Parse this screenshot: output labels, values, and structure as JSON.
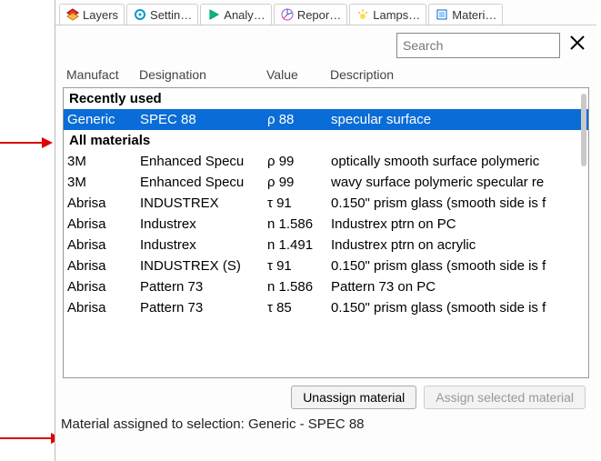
{
  "tabs": [
    {
      "label": "Layers"
    },
    {
      "label": "Settin…"
    },
    {
      "label": "Analy…"
    },
    {
      "label": "Repor…"
    },
    {
      "label": "Lamps…"
    },
    {
      "label": "Materi…"
    }
  ],
  "search": {
    "placeholder": "Search"
  },
  "columns": {
    "manufacturer": "Manufact",
    "designation": "Designation",
    "value": "Value",
    "description": "Description"
  },
  "sections": {
    "recent": "Recently used",
    "all": "All materials"
  },
  "recent_rows": [
    {
      "m": "Generic",
      "d": "SPEC 88",
      "v": "ρ 88",
      "desc": "specular surface",
      "selected": true
    }
  ],
  "all_rows": [
    {
      "m": "3M",
      "d": "Enhanced Specu",
      "v": "ρ 99",
      "desc": "optically smooth surface polymeric"
    },
    {
      "m": "3M",
      "d": "Enhanced Specu",
      "v": "ρ 99",
      "desc": "wavy surface polymeric specular re"
    },
    {
      "m": "Abrisa",
      "d": "INDUSTREX",
      "v": "τ 91",
      "desc": "0.150\" prism glass (smooth side is f"
    },
    {
      "m": "Abrisa",
      "d": "Industrex",
      "v": "n 1.586",
      "desc": "Industrex ptrn on PC"
    },
    {
      "m": "Abrisa",
      "d": "Industrex",
      "v": "n 1.491",
      "desc": "Industrex ptrn on acrylic"
    },
    {
      "m": "Abrisa",
      "d": "INDUSTREX (S)",
      "v": "τ 91",
      "desc": "0.150\" prism glass (smooth side is f"
    },
    {
      "m": "Abrisa",
      "d": "Pattern 73",
      "v": "n 1.586",
      "desc": "Pattern 73 on PC"
    },
    {
      "m": "Abrisa",
      "d": "Pattern 73",
      "v": "τ 85",
      "desc": "0.150\" prism glass (smooth side is f"
    }
  ],
  "buttons": {
    "unassign": "Unassign material",
    "assign": "Assign selected material"
  },
  "status_prefix": "Material assigned to selection: ",
  "status_value": "Generic - SPEC 88"
}
